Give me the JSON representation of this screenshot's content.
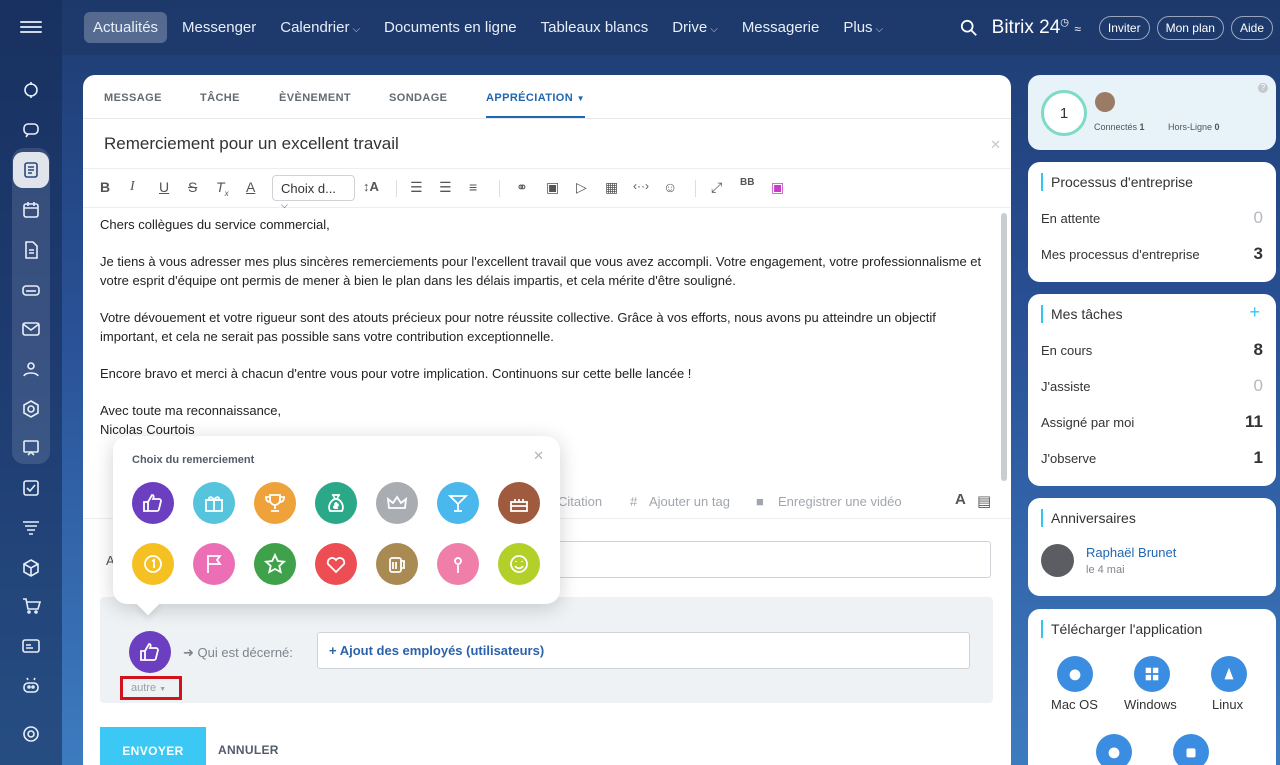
{
  "topnav": {
    "items": [
      "Actualités",
      "Messenger",
      "Calendrier",
      "Documents en ligne",
      "Tableaux blancs",
      "Drive",
      "Messagerie",
      "Plus"
    ],
    "brand": "Bitrix 24",
    "invite": "Inviter",
    "plan": "Mon plan",
    "help": "Aide"
  },
  "composer": {
    "tabs": [
      "MESSAGE",
      "TÂCHE",
      "ÈVÈNEMENT",
      "SONDAGE",
      "APPRÉCIATION"
    ],
    "title": "Remerciement pour un excellent travail",
    "style_select": "Choix d...",
    "body": [
      "Chers collègues du service commercial,",
      "Je tiens à vous adresser mes plus sincères remerciements pour l'excellent travail que vous avez accompli. Votre engagement, votre professionnalisme et votre esprit d'équipe ont permis de mener à bien le plan dans les délais impartis, et cela mérite d'être souligné.",
      "Votre dévouement et votre rigueur sont des atouts précieux pour notre réussite collective. Grâce à vos efforts, nous avons pu atteindre un objectif important, et cela ne serait pas possible sans votre contribution exceptionnelle.",
      "Encore bravo et merci à chacun d'entre vous pour votre implication. Continuons sur cette belle lancée !",
      "Avec toute ma reconnaissance,\nNicolas Courtois"
    ],
    "citation": "Citation",
    "add_tag": "Ajouter un tag",
    "record_video": "Enregistrer une vidéo",
    "to_label": "A",
    "grant_label": "Qui est décerné:",
    "add_employees": "+ Ajout des employés (utilisateurs)",
    "autre": "autre",
    "send": "ENVOYER",
    "cancel": "ANNULER"
  },
  "popup": {
    "title": "Choix du remerciement",
    "badges": [
      {
        "icon": "thumbs-up",
        "color": "#6b3fc0"
      },
      {
        "icon": "gift",
        "color": "#55c4dc"
      },
      {
        "icon": "trophy",
        "color": "#f0a23a"
      },
      {
        "icon": "money-bag",
        "color": "#2aa887"
      },
      {
        "icon": "crown",
        "color": "#a9adb1"
      },
      {
        "icon": "cocktail",
        "color": "#4ab8ec"
      },
      {
        "icon": "cake",
        "color": "#a05a3e"
      },
      {
        "icon": "coin",
        "color": "#f5c021"
      },
      {
        "icon": "flag",
        "color": "#ec6fb5"
      },
      {
        "icon": "star",
        "color": "#3fa14a"
      },
      {
        "icon": "heart",
        "color": "#ed4e53"
      },
      {
        "icon": "beer",
        "color": "#a88a52"
      },
      {
        "icon": "flower",
        "color": "#ef7fa8"
      },
      {
        "icon": "smile",
        "color": "#b3cf29"
      }
    ]
  },
  "presence": {
    "count": "1",
    "connected_label": "Connectés",
    "connected": "1",
    "offline_label": "Hors-Ligne",
    "offline": "0"
  },
  "processes": {
    "title": "Processus d'entreprise",
    "rows": [
      {
        "label": "En attente",
        "value": "0"
      },
      {
        "label": "Mes processus d'entreprise",
        "value": "3"
      }
    ]
  },
  "tasks": {
    "title": "Mes tâches",
    "rows": [
      {
        "label": "En cours",
        "value": "8"
      },
      {
        "label": "J'assiste",
        "value": "0"
      },
      {
        "label": "Assigné par moi",
        "value": "11"
      },
      {
        "label": "J'observe",
        "value": "1"
      }
    ]
  },
  "birthdays": {
    "title": "Anniversaires",
    "name": "Raphaël Brunet",
    "date": "le 4 mai"
  },
  "apps": {
    "title": "Télécharger l'application",
    "items": [
      "Mac OS",
      "Windows",
      "Linux"
    ]
  }
}
